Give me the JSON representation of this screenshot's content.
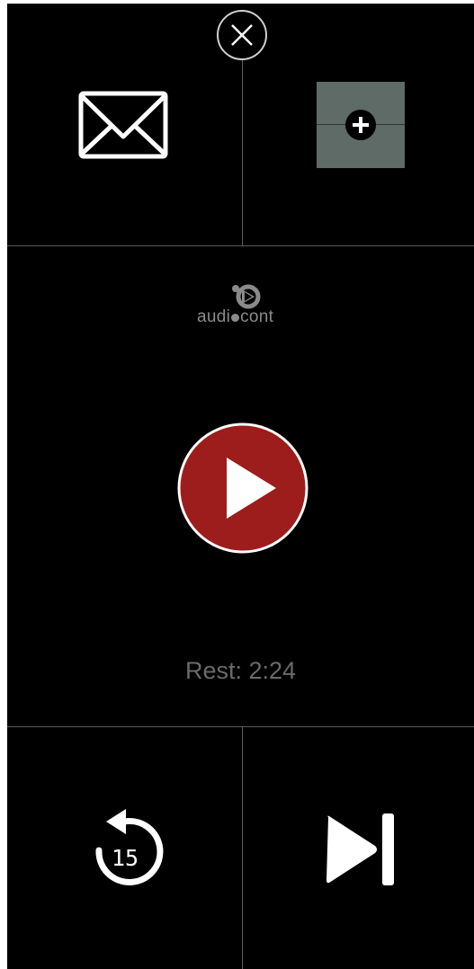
{
  "header": {
    "close_icon": "close-icon",
    "mail_icon": "envelope-icon",
    "add_icon": "plus-circle-icon"
  },
  "player": {
    "brand": "audiocont",
    "brand_prefix": "audi",
    "brand_suffix": "cont",
    "play_icon": "play-icon",
    "remaining_time": "Rest: 2:24",
    "accent_color": "#9d1c1c"
  },
  "controls": {
    "replay_icon": "replay-15-icon",
    "replay_seconds": "15",
    "skip_icon": "skip-next-icon"
  }
}
